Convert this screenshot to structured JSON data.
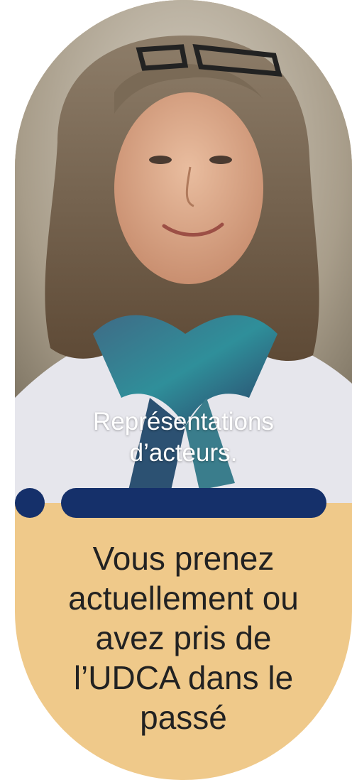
{
  "photo": {
    "icon": "woman-portrait-photo"
  },
  "caption": {
    "line1": "Représentations",
    "line2": "d’acteurs."
  },
  "headline": {
    "line1": "Vous prenez",
    "line2": "actuellement ou",
    "line3": "avez pris de",
    "line4": "l’UDCA dans le",
    "line5": "passé"
  },
  "colors": {
    "card_background": "#efc98a",
    "accent_navy": "#15306a",
    "text_dark": "#222222",
    "caption_text": "#ffffff"
  }
}
